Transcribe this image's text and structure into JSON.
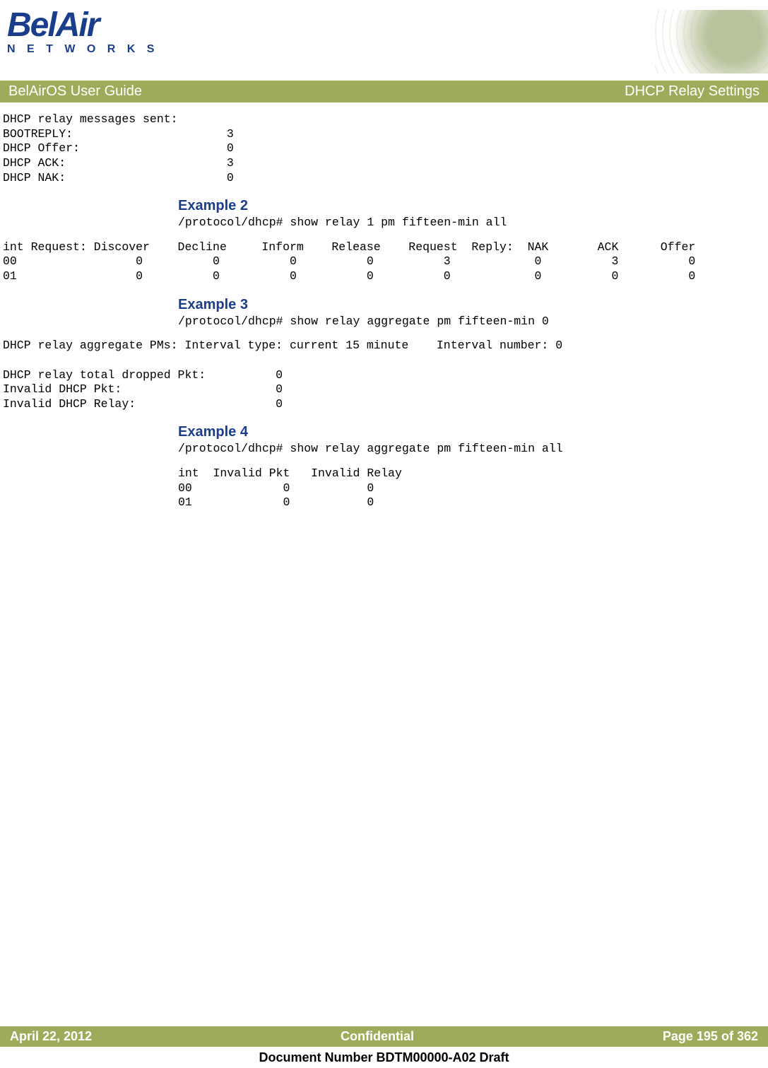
{
  "logo": {
    "line1": "BelAir",
    "line2": "N E T W O R K S"
  },
  "titleBar": {
    "left": "BelAirOS User Guide",
    "right": "DHCP Relay Settings"
  },
  "block1": "DHCP relay messages sent:\nBOOTREPLY:                      3\nDHCP Offer:                     0\nDHCP ACK:                       3\nDHCP NAK:                       0",
  "example2": {
    "heading": "Example 2",
    "cmd": "/protocol/dhcp# show relay 1 pm fifteen-min all",
    "table": "int Request: Discover    Decline     Inform    Release    Request  Reply:  NAK       ACK      Offer\n00                 0          0          0          0          3            0          3          0\n01                 0          0          0          0          0            0          0          0"
  },
  "example3": {
    "heading": "Example 3",
    "cmd": "/protocol/dhcp# show relay aggregate pm fifteen-min 0",
    "body": "DHCP relay aggregate PMs: Interval type: current 15 minute    Interval number: 0\n\nDHCP relay total dropped Pkt:          0\nInvalid DHCP Pkt:                      0\nInvalid DHCP Relay:                    0"
  },
  "example4": {
    "heading": "Example 4",
    "cmd": "/protocol/dhcp# show relay aggregate pm fifteen-min all",
    "body": "int  Invalid Pkt   Invalid Relay\n00             0           0\n01             0           0"
  },
  "footer": {
    "left": "April 22, 2012",
    "center": "Confidential",
    "right": "Page 195 of 362"
  },
  "docNumber": "Document Number BDTM00000-A02 Draft"
}
